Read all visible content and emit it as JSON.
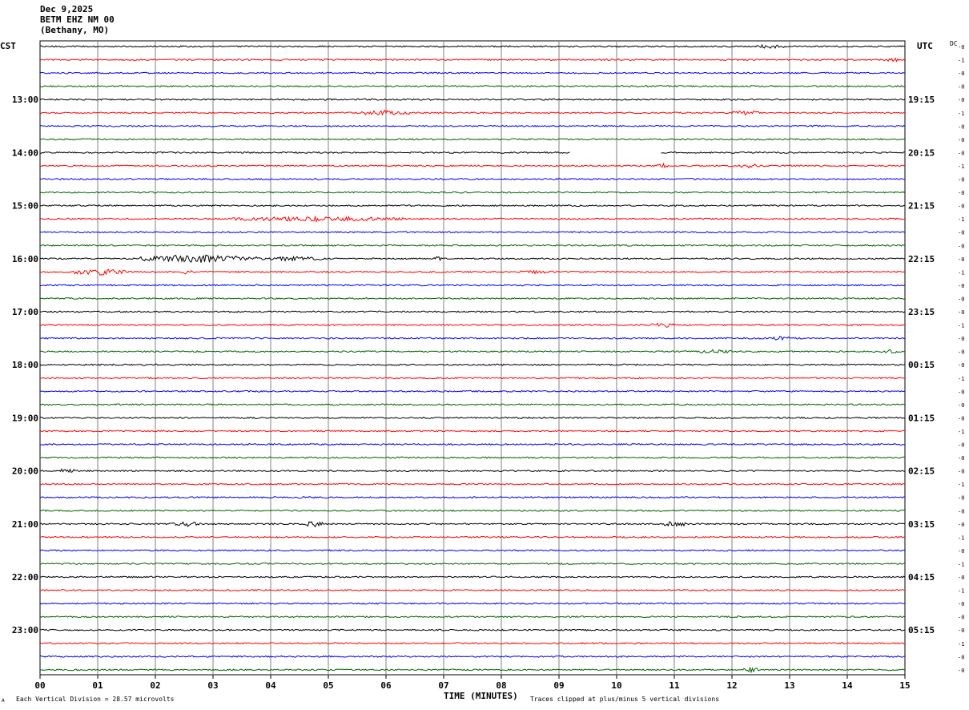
{
  "header": {
    "date": "Dec 9,2025",
    "station": "BETM EHZ NM 00",
    "location": "(Bethany, MO)"
  },
  "left_axis_title": "CST",
  "right_axis_title": "UTC",
  "dc_label": "DC",
  "footer": {
    "scale_note": "Each Vertical Division =   28.57 microvolts",
    "clip_note": "Traces clipped at plus/minus 5 vertical divisions",
    "corner_mark": "A"
  },
  "chart_data": {
    "type": "line",
    "xlabel": "TIME (MINUTES)",
    "x_ticks": [
      "00",
      "01",
      "02",
      "03",
      "04",
      "05",
      "06",
      "07",
      "08",
      "09",
      "10",
      "11",
      "12",
      "13",
      "14",
      "15"
    ],
    "xlim": [
      0,
      15
    ],
    "trace_colors": [
      "#000000",
      "#ff0000",
      "#0000ff",
      "#006400"
    ],
    "grid": true,
    "left_labels": [
      "13:00",
      "14:00",
      "15:00",
      "16:00",
      "17:00",
      "18:00",
      "19:00",
      "20:00",
      "21:00",
      "22:00",
      "23:00"
    ],
    "right_labels": [
      "19:15",
      "20:15",
      "21:15",
      "22:15",
      "23:15",
      "00:15",
      "01:15",
      "02:15",
      "03:15",
      "04:15",
      "05:15"
    ],
    "dc_offsets": [
      "-0",
      "-1",
      "-0",
      "-0",
      "-0",
      "-1",
      "-0",
      "-0",
      "-0",
      "-1",
      "-0",
      "-0",
      "-0",
      "-1",
      "-0",
      "-0",
      "-0",
      "-1",
      "-0",
      "-0",
      "-0",
      "-1",
      "-0",
      "-0",
      "-0",
      "-1",
      "-0",
      "-0",
      "-0",
      "-1",
      "-0",
      "-0",
      "-0",
      "-1",
      "-0",
      "-0",
      "-0",
      "-1",
      "-0",
      "-1",
      "-0",
      "-1",
      "-0",
      "-0",
      "-0",
      "-1",
      "-0",
      "-0"
    ],
    "events": [
      {
        "row": 0,
        "start": 12.4,
        "end": 12.9,
        "amp": 1.8
      },
      {
        "row": 1,
        "start": 14.6,
        "end": 15.0,
        "amp": 1.5
      },
      {
        "row": 5,
        "start": 5.5,
        "end": 6.4,
        "amp": 2.5
      },
      {
        "row": 5,
        "start": 12.0,
        "end": 12.5,
        "amp": 2.0
      },
      {
        "row": 9,
        "start": 10.7,
        "end": 10.9,
        "amp": 2.0
      },
      {
        "row": 9,
        "start": 12.1,
        "end": 12.5,
        "amp": 2.0
      },
      {
        "row": 13,
        "start": 3.3,
        "end": 6.3,
        "amp": 2.4
      },
      {
        "row": 16,
        "start": 1.7,
        "end": 3.8,
        "amp": 4.2
      },
      {
        "row": 16,
        "start": 3.8,
        "end": 4.9,
        "amp": 2.0
      },
      {
        "row": 16,
        "start": 6.8,
        "end": 7.0,
        "amp": 2.0
      },
      {
        "row": 17,
        "start": 0.6,
        "end": 1.5,
        "amp": 3.5
      },
      {
        "row": 17,
        "start": 2.4,
        "end": 2.7,
        "amp": 2.0
      },
      {
        "row": 17,
        "start": 8.3,
        "end": 8.9,
        "amp": 1.5
      },
      {
        "row": 21,
        "start": 10.6,
        "end": 11.0,
        "amp": 2.5
      },
      {
        "row": 22,
        "start": 12.7,
        "end": 13.0,
        "amp": 2.0
      },
      {
        "row": 23,
        "start": 11.4,
        "end": 12.0,
        "amp": 1.8
      },
      {
        "row": 23,
        "start": 14.6,
        "end": 14.9,
        "amp": 1.5
      },
      {
        "row": 32,
        "start": 0.3,
        "end": 0.6,
        "amp": 2.0
      },
      {
        "row": 36,
        "start": 2.3,
        "end": 2.8,
        "amp": 2.5
      },
      {
        "row": 36,
        "start": 4.6,
        "end": 4.9,
        "amp": 3.0
      },
      {
        "row": 36,
        "start": 10.8,
        "end": 11.2,
        "amp": 2.8
      },
      {
        "row": 47,
        "start": 12.2,
        "end": 12.5,
        "amp": 2.5
      }
    ],
    "gaps": [
      {
        "row": 8,
        "start": 9.2,
        "end": 10.75
      }
    ]
  }
}
